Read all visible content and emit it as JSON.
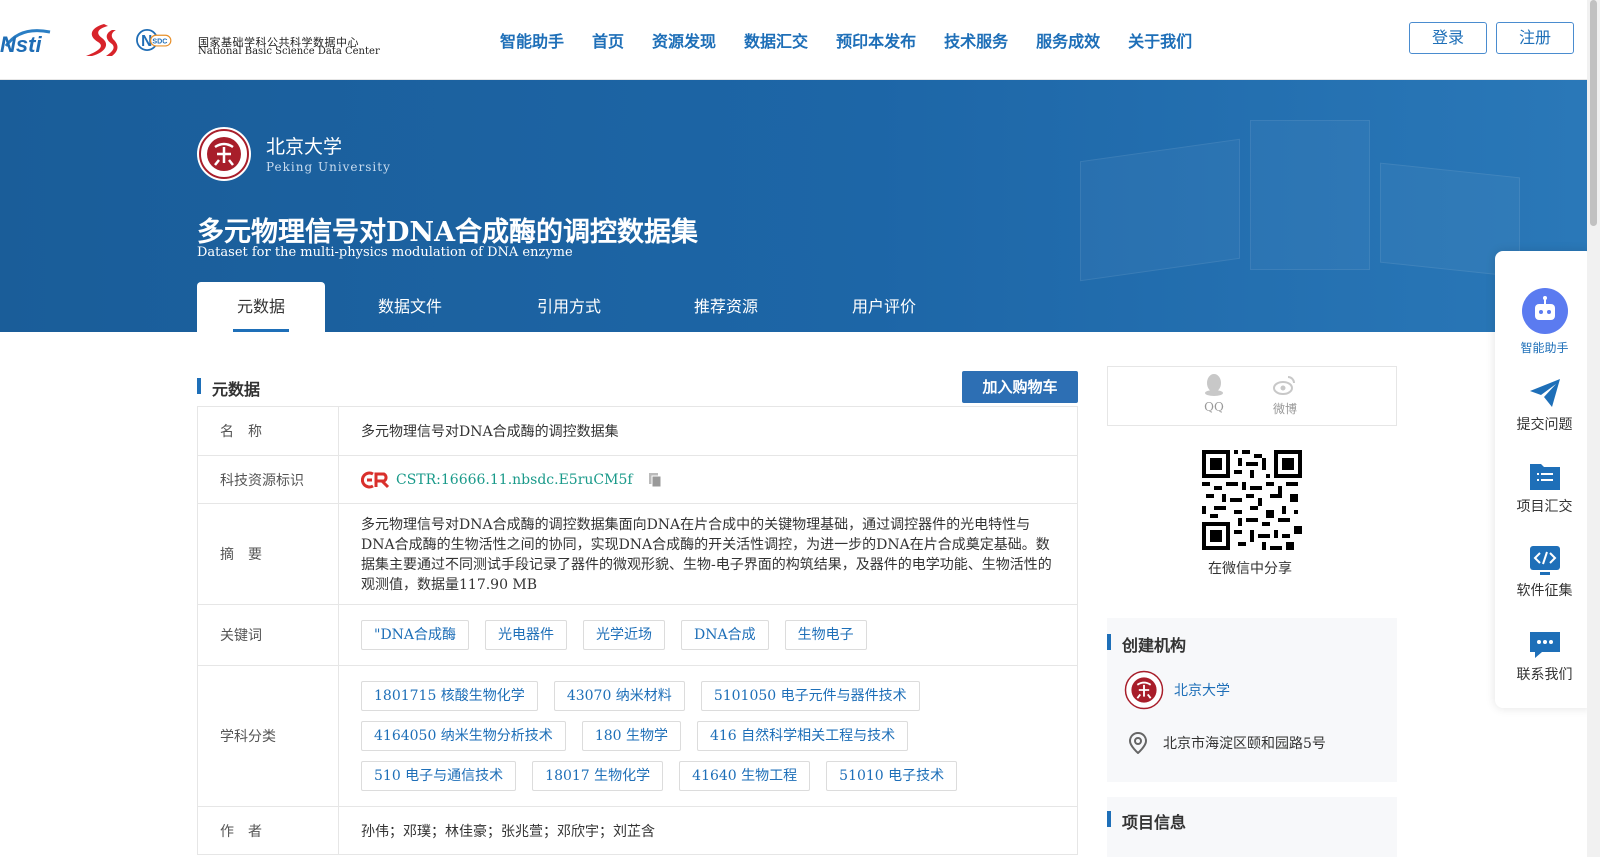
{
  "header": {
    "logo_cstr_text": "CSTR",
    "nsdc_cn": "国家基础学科公共科学数据中心",
    "nsdc_en": "National Basic Science Data Center",
    "nav": [
      "智能助手",
      "首页",
      "资源发现",
      "数据汇交",
      "预印本发布",
      "技术服务",
      "服务成效",
      "关于我们"
    ],
    "login": "登录",
    "register": "注册"
  },
  "banner": {
    "org_name": "北京大学",
    "org_en": "Peking University",
    "title": "多元物理信号对DNA合成酶的调控数据集",
    "subtitle": "Dataset for the multi-physics modulation of DNA enzyme",
    "tabs": [
      "元数据",
      "数据文件",
      "引用方式",
      "推荐资源",
      "用户评价"
    ],
    "active_tab": 0
  },
  "metadata": {
    "section_title": "元数据",
    "cart_button": "加入购物车",
    "rows": {
      "name": {
        "key": "名　称",
        "value": "多元物理信号对DNA合成酶的调控数据集"
      },
      "cstr": {
        "key": "科技资源标识",
        "value": "CSTR:16666.11.nbsdc.E5ruCM5f"
      },
      "abstract": {
        "key": "摘　要",
        "value": "多元物理信号对DNA合成酶的调控数据集面向DNA在片合成中的关键物理基础，通过调控器件的光电特性与DNA合成酶的生物活性之间的协同，实现DNA合成酶的开关活性调控，为进一步的DNA在片合成奠定基础。数据集主要通过不同测试手段记录了器件的微观形貌、生物-电子界面的构筑结果，及器件的电学功能、生物活性的观测值，数据量117.90 MB"
      },
      "keywords": {
        "key": "关键词",
        "tags": [
          "\"DNA合成酶",
          "光电器件",
          "光学近场",
          "DNA合成",
          "生物电子"
        ]
      },
      "subjects": {
        "key": "学科分类",
        "tags": [
          [
            "1801715 核酸生物化学",
            "43070 纳米材料",
            "5101050 电子元件与器件技术"
          ],
          [
            "4164050 纳米生物分析技术",
            "180 生物学",
            "416 自然科学相关工程与技术"
          ],
          [
            "510 电子与通信技术",
            "18017 生物化学",
            "41640 生物工程",
            "51010 电子技术"
          ]
        ]
      },
      "authors": {
        "key": "作　者",
        "value": "孙伟；邓璞；林佳豪；张兆萱；邓欣宇；刘芷含"
      }
    }
  },
  "sidebar": {
    "share": [
      {
        "label": "QQ"
      },
      {
        "label": "微博"
      }
    ],
    "qr_caption": "在微信中分享",
    "creator_title": "创建机构",
    "creator_name": "北京大学",
    "creator_address": "北京市海淀区颐和园路5号",
    "project_title": "项目信息"
  },
  "tools": [
    {
      "label": "智能助手",
      "icon": "robot-icon"
    },
    {
      "label": "提交问题",
      "icon": "paper-plane-icon"
    },
    {
      "label": "项目汇交",
      "icon": "folder-list-icon"
    },
    {
      "label": "软件征集",
      "icon": "code-icon"
    },
    {
      "label": "联系我们",
      "icon": "chat-icon"
    }
  ],
  "colors": {
    "primary": "#1e6fb8",
    "banner": "#1d66a7",
    "cstr": "#d9302c"
  }
}
